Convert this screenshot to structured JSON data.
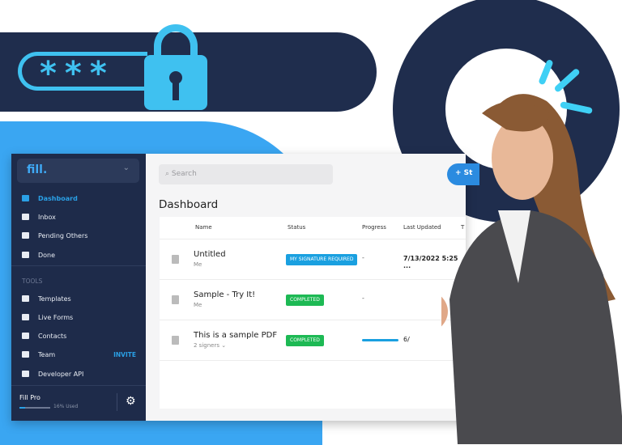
{
  "hero": {
    "password_mask": "***"
  },
  "colors": {
    "navy": "#1e2b4a",
    "accent": "#2aa0e6",
    "cyan": "#3fc1f0",
    "completed": "#1db954",
    "signature": "#1aa0e0"
  },
  "sidebar": {
    "logo": "fill.",
    "items": [
      {
        "label": "Dashboard",
        "icon": "home-icon",
        "active": true
      },
      {
        "label": "Inbox",
        "icon": "inbox-icon"
      },
      {
        "label": "Pending Others",
        "icon": "users-icon"
      },
      {
        "label": "Done",
        "icon": "folder-check-icon"
      }
    ],
    "tools_header": "TOOLS",
    "tools": [
      {
        "label": "Templates",
        "icon": "template-icon"
      },
      {
        "label": "Live Forms",
        "icon": "form-icon"
      },
      {
        "label": "Contacts",
        "icon": "contact-icon"
      },
      {
        "label": "Team",
        "icon": "team-icon",
        "action": "INVITE"
      },
      {
        "label": "Developer API",
        "icon": "api-icon"
      }
    ],
    "plan": "Fill Pro",
    "usage_label": "16% Used",
    "usage_percent": 16
  },
  "main": {
    "search_placeholder": "Search",
    "new_button": "+ St",
    "title": "Dashboard",
    "columns": [
      "Name",
      "Status",
      "Progress",
      "Last Updated",
      "T"
    ],
    "rows": [
      {
        "name": "Untitled",
        "sub": "Me",
        "status": "MY SIGNATURE REQUIRED",
        "status_color": "#1aa0e0",
        "progress": "-",
        "updated": "7/13/2022 5:25 ..."
      },
      {
        "name": "Sample - Try It!",
        "sub": "Me",
        "status": "COMPLETED",
        "status_color": "#1db954",
        "progress": "-",
        "updated": ""
      },
      {
        "name": "This is a sample PDF",
        "sub": "2 signers ⌄",
        "status": "COMPLETED",
        "status_color": "#1db954",
        "progress_percent": 100,
        "updated": "6/"
      }
    ]
  }
}
